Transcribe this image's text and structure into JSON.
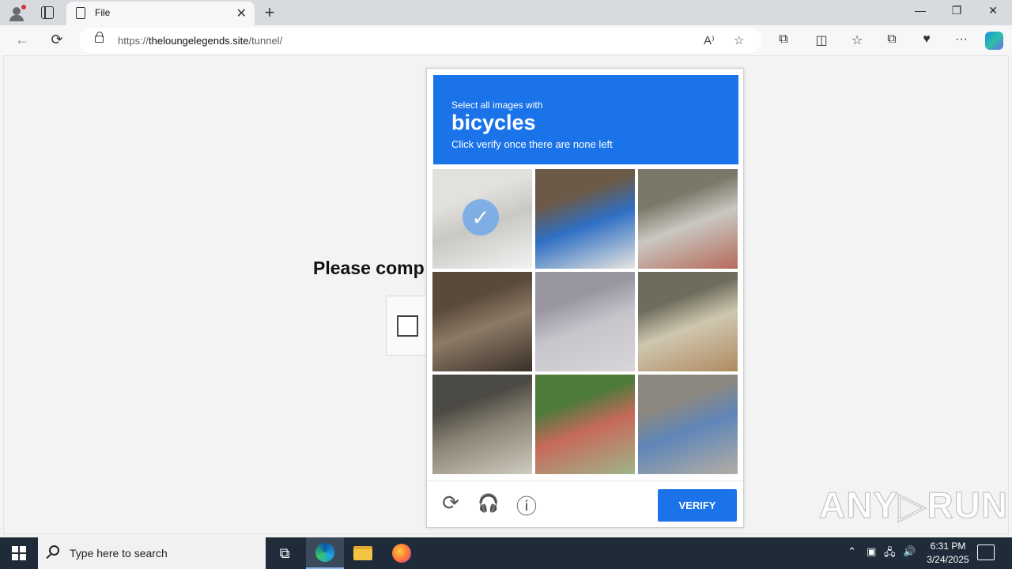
{
  "browser": {
    "tab_title": "File",
    "tab_close": "✕",
    "new_tab": "+",
    "url_prefix": "https://",
    "url_domain": "theloungelegends.site",
    "url_path": "/tunnel/",
    "window_controls": {
      "minimize": "—",
      "restore": "❐",
      "close": "✕"
    },
    "nav": {
      "back": "←",
      "refresh": "⟳"
    },
    "toolbar_icons": {
      "read_aloud": "A⁾",
      "favorite": "☆",
      "extensions": "⧉",
      "split": "◫",
      "favorites": "☆",
      "collections": "⧉",
      "wallet": "♥",
      "more": "···"
    }
  },
  "page": {
    "heading_partial": "Please comp"
  },
  "captcha": {
    "instruction_pre": "Select all images with",
    "target_object": "bicycles",
    "instruction_post": "Click verify once there are none left",
    "verify_label": "VERIFY",
    "check_glyph": "✓",
    "tiles": [
      {
        "selected": true,
        "colors": [
          "#d9d7d2",
          "#b8b6b1",
          "#efefee"
        ]
      },
      {
        "selected": false,
        "colors": [
          "#6b5a48",
          "#2f6fc4",
          "#e8e6e0"
        ]
      },
      {
        "selected": false,
        "colors": [
          "#7a7868",
          "#c9c8c1",
          "#b56a5a"
        ]
      },
      {
        "selected": false,
        "colors": [
          "#5a4a3a",
          "#8c7a66",
          "#3a3028"
        ]
      },
      {
        "selected": false,
        "colors": [
          "#9a96a0",
          "#c7c4cc",
          "#d8d6d8"
        ]
      },
      {
        "selected": false,
        "colors": [
          "#6e6c5c",
          "#cfc7b0",
          "#b08a60"
        ]
      },
      {
        "selected": false,
        "colors": [
          "#4c4a44",
          "#8a8474",
          "#cfcbbf"
        ]
      },
      {
        "selected": false,
        "colors": [
          "#4e7a3a",
          "#c76a5a",
          "#9fb48a"
        ]
      },
      {
        "selected": false,
        "colors": [
          "#8c8880",
          "#5f86b8",
          "#b4aea4"
        ]
      }
    ],
    "footer_icons": {
      "refresh": "⟳",
      "audio": "🎧",
      "info": "ⓘ"
    }
  },
  "watermark": "ANY▷RUN",
  "taskbar": {
    "search_placeholder": "Type here to search",
    "task_view": "⧉",
    "clock_time": "6:31 PM",
    "clock_date": "3/24/2025",
    "tray": {
      "chevron": "⌃",
      "network": "🖧",
      "volume": "🔊"
    }
  }
}
